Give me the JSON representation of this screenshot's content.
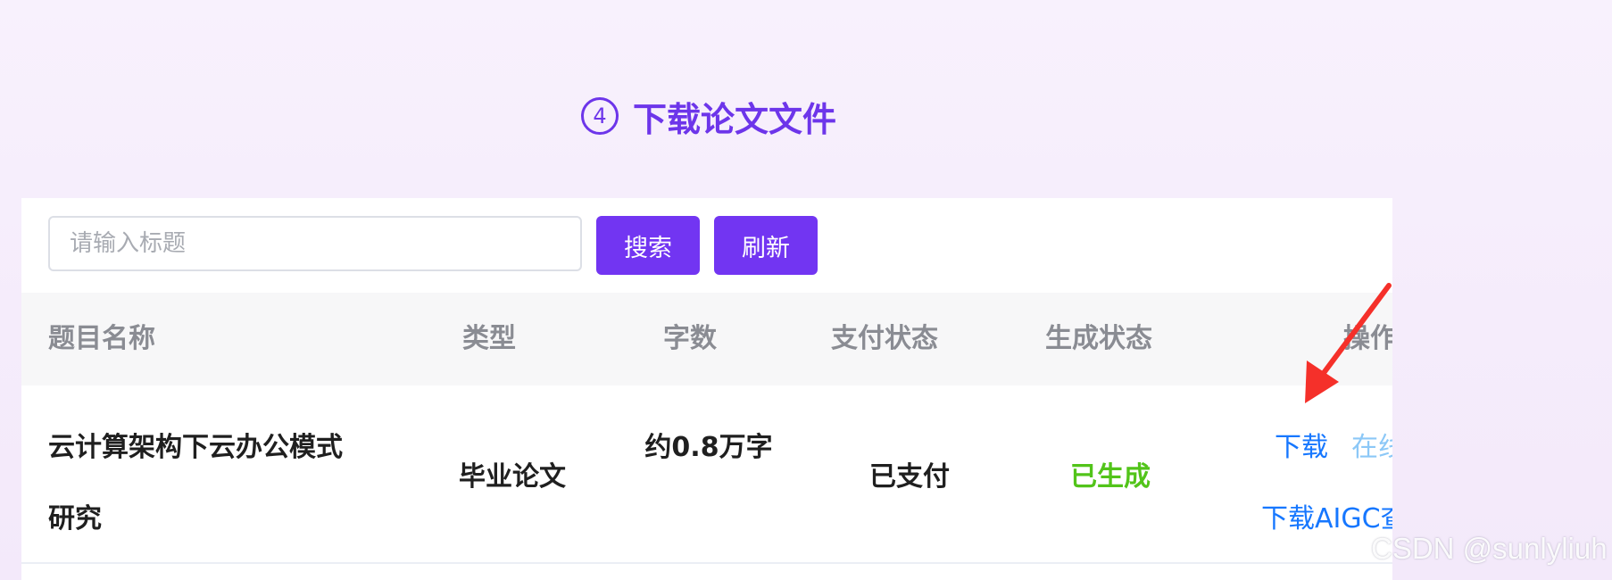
{
  "step": {
    "number": "4",
    "title": "下载论文文件"
  },
  "toolbar": {
    "search_placeholder": "请输入标题",
    "search_value": "",
    "search_label": "搜索",
    "refresh_label": "刷新"
  },
  "table": {
    "columns": [
      "题目名称",
      "类型",
      "字数",
      "支付状态",
      "生成状态",
      "操作"
    ],
    "rows": [
      {
        "title": "云计算架构下云办公模式研究",
        "type": "毕业论文",
        "words": "约0.8万字",
        "pay_status": "已支付",
        "gen_status": "已生成",
        "actions": [
          "下载",
          "在线",
          "下载AIGC查"
        ]
      }
    ]
  },
  "colors": {
    "accent": "#7235f2",
    "status_generated": "#52c41a",
    "link": "#1677ff",
    "annotation_arrow": "#f5302a"
  },
  "watermark": "CSDN @sunlyliuh"
}
